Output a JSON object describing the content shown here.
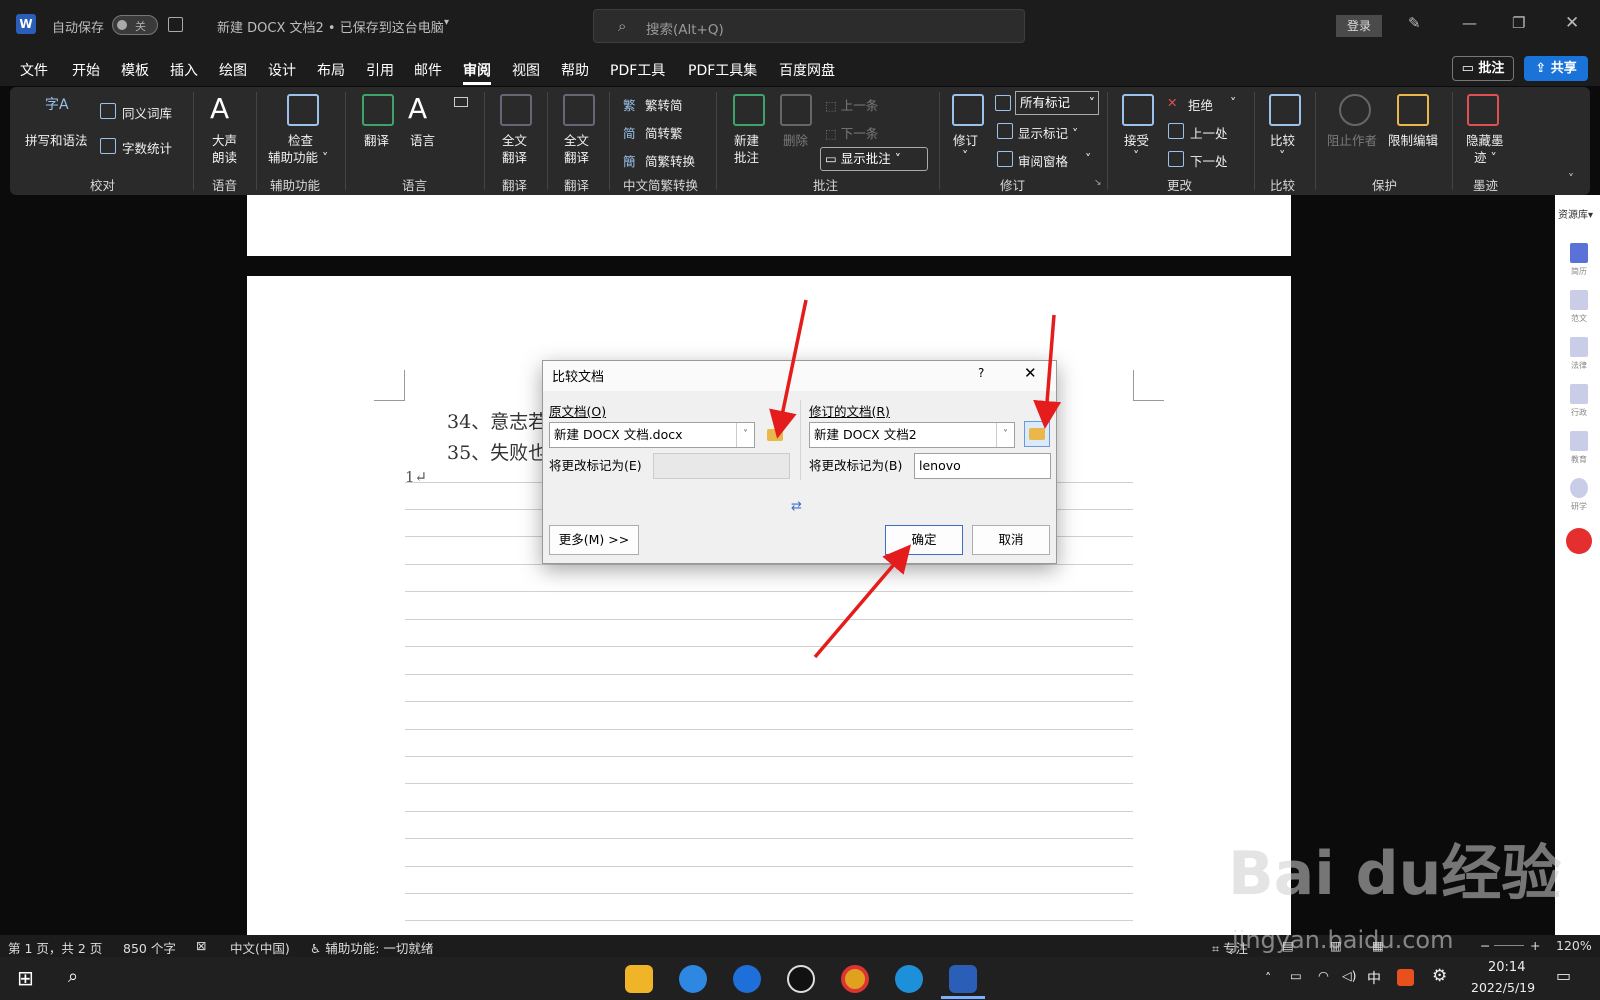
{
  "titlebar": {
    "autosave_label": "自动保存",
    "autosave_toggle": "关",
    "doc_title": "新建 DOCX 文档2 • 已保存到这台电脑",
    "search_placeholder": "搜索(Alt+Q)",
    "login_label": "登录"
  },
  "menu": {
    "items": [
      "文件",
      "开始",
      "模板",
      "插入",
      "绘图",
      "设计",
      "布局",
      "引用",
      "邮件",
      "审阅",
      "视图",
      "帮助",
      "PDF工具",
      "PDF工具集",
      "百度网盘"
    ],
    "active": "审阅",
    "comment_btn": "批注",
    "share_btn": "共享"
  },
  "ribbon": {
    "proof": {
      "spell": "拼写和语法",
      "spell_icon": "字A",
      "thesaurus": "同义词库",
      "wordcount": "字数统计",
      "group": "校对"
    },
    "speech": {
      "read": "大声\n朗读",
      "read1": "大声",
      "read2": "朗读",
      "group": "语音"
    },
    "access": {
      "check1": "检查",
      "check2": "辅助功能 ˅",
      "group": "辅助功能"
    },
    "lang": {
      "translate": "翻译",
      "language": "语言",
      "group": "语言"
    },
    "trans1": {
      "label1": "全文",
      "label2": "翻译",
      "group": "翻译"
    },
    "trans2": {
      "label1": "全文",
      "label2": "翻译",
      "group": "翻译"
    },
    "chinese": {
      "t2s": "繁转简",
      "s2t": "简转繁",
      "convert": "简繁转换",
      "group": "中文简繁转换"
    },
    "comments": {
      "new1": "新建",
      "new2": "批注",
      "delete": "删除",
      "prev": "上一条",
      "next": "下一条",
      "show": "显示批注",
      "group": "批注"
    },
    "tracking": {
      "track": "修订",
      "markup": "所有标记",
      "showmarkup": "显示标记 ˅",
      "pane": "审阅窗格",
      "group": "修订"
    },
    "changes": {
      "accept": "接受",
      "reject": "拒绝",
      "prev": "上一处",
      "next": "下一处",
      "group": "更改"
    },
    "compare": {
      "label": "比较",
      "group": "比较"
    },
    "protect": {
      "block1": "阻止作者",
      "restrict": "限制编辑",
      "group": "保护"
    },
    "ink": {
      "hide1": "隐藏墨",
      "hide2": "迹 ˅",
      "group": "墨迹"
    }
  },
  "document": {
    "line34": "34、意志若",
    "line35": "35、失败也",
    "line1": "1↵"
  },
  "rightpanel": {
    "header": "资源库",
    "items": [
      "简历",
      "范文",
      "法律",
      "行政",
      "教育",
      "研学"
    ]
  },
  "dialog": {
    "title": "比较文档",
    "help": "?",
    "original_label": "原文档(O)",
    "original_value": "新建 DOCX 文档.docx",
    "original_mark_label": "将更改标记为(E)",
    "original_mark_value": "",
    "revised_label": "修订的文档(R)",
    "revised_value": "新建 DOCX 文档2",
    "revised_mark_label": "将更改标记为(B)",
    "revised_mark_value": "lenovo",
    "swap_icon": "⇄",
    "more_btn": "更多(M) >>",
    "ok_btn": "确定",
    "cancel_btn": "取消"
  },
  "statusbar": {
    "page": "第 1 页，共 2 页",
    "words": "850 个字",
    "lang": "中文(中国)",
    "access": "辅助功能: 一切就绪",
    "focus": "专注",
    "zoom": "120%"
  },
  "taskbar": {
    "time": "20:14",
    "date": "2022/5/19",
    "ime": "中"
  },
  "watermark": {
    "text": "Bai du经验",
    "url": "jingyan.baidu.com"
  },
  "colors": {
    "accent": "#1a73d9",
    "ribbon_bg": "#2a2a2a",
    "arrow": "#e51c1c"
  }
}
